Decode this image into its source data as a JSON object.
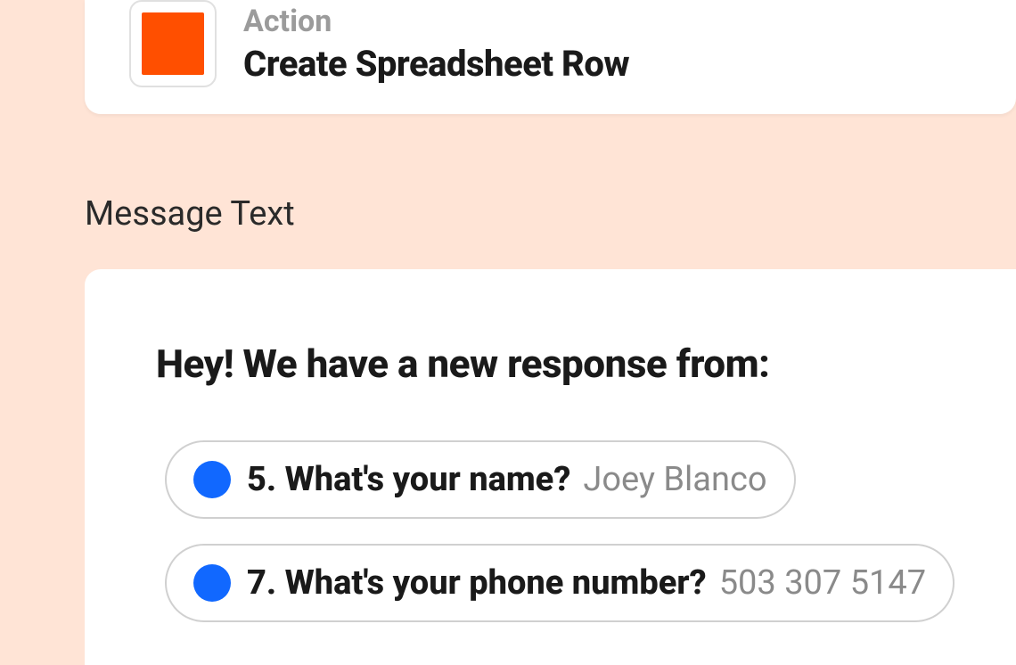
{
  "action": {
    "label": "Action",
    "title": "Create Spreadsheet Row"
  },
  "section_label": "Message Text",
  "message": {
    "heading": "Hey! We have a new response from:",
    "responses": [
      {
        "question": "5. What's your name?",
        "answer": "Joey Blanco"
      },
      {
        "question": "7. What's your phone number?",
        "answer": "503 307 5147"
      }
    ]
  }
}
